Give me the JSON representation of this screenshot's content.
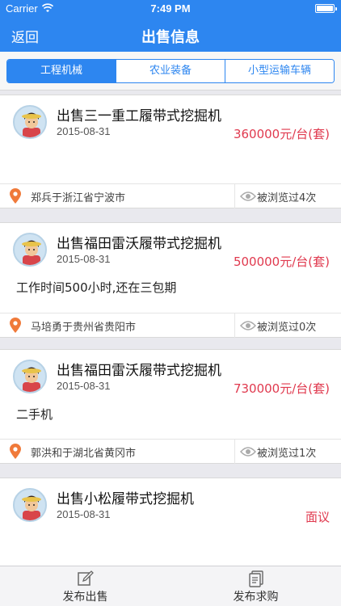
{
  "status": {
    "carrier": "Carrier",
    "time": "7:49 PM"
  },
  "nav": {
    "back": "返回",
    "title": "出售信息"
  },
  "tabs": [
    "工程机械",
    "农业装备",
    "小型运输车辆"
  ],
  "listings": [
    {
      "title": "出售三一重工履带式挖掘机",
      "date": "2015-08-31",
      "price": "360000元/台(套)",
      "desc": "",
      "location": "郑兵于浙江省宁波市",
      "views": "被浏览过4次"
    },
    {
      "title": "出售福田雷沃履带式挖掘机",
      "date": "2015-08-31",
      "price": "500000元/台(套)",
      "desc": "工作时间500小时,还在三包期",
      "location": "马培勇于贵州省贵阳市",
      "views": "被浏览过0次"
    },
    {
      "title": "出售福田雷沃履带式挖掘机",
      "date": "2015-08-31",
      "price": "730000元/台(套)",
      "desc": "二手机",
      "location": "郭洪和于湖北省黄冈市",
      "views": "被浏览过1次"
    },
    {
      "title": "出售小松履带式挖掘机",
      "date": "2015-08-31",
      "price": "面议",
      "desc": ""
    }
  ],
  "tabbar": {
    "sell": "发布出售",
    "buy": "发布求购"
  },
  "colors": {
    "primary": "#2d86f0",
    "price": "#e0394e",
    "pin": "#f07a3a"
  },
  "icons": [
    "wifi-icon",
    "battery-icon",
    "avatar-icon",
    "location-pin-icon",
    "eye-icon",
    "edit-icon",
    "document-icon"
  ]
}
